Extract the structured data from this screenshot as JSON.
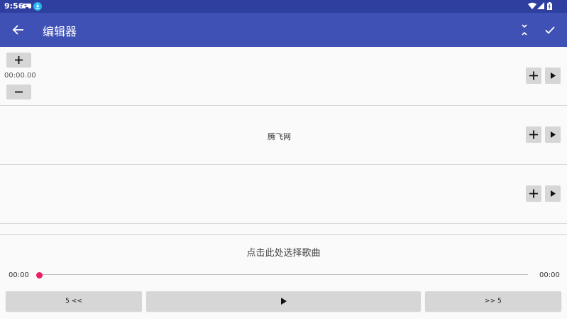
{
  "status_bar": {
    "time": "9:56",
    "icons": [
      "gamepad-icon",
      "download-icon",
      "wifi-icon",
      "signal-icon",
      "battery-icon"
    ]
  },
  "app_bar": {
    "title": "编辑器",
    "color": "#3f51b5",
    "actions": [
      "back-arrow-icon",
      "collapse-icon",
      "check-icon"
    ]
  },
  "rows": [
    {
      "time": "00:00.00",
      "label": ""
    },
    {
      "label": "腾飞网"
    },
    {
      "label": ""
    }
  ],
  "player": {
    "select_song": "点击此处选择歌曲",
    "current_time": "00:00",
    "total_time": "00:00",
    "progress": 0,
    "thumb_color": "#e91e63",
    "rewind_label": "5 <<",
    "forward_label": ">> 5"
  }
}
